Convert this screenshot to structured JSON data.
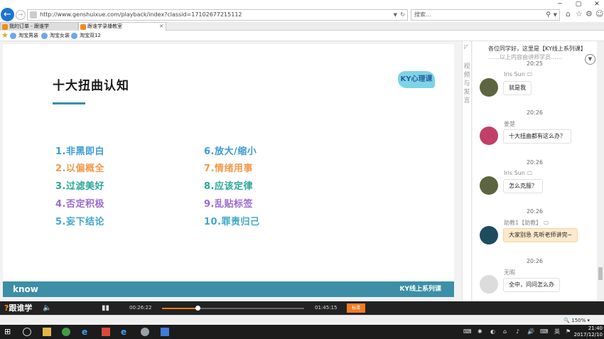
{
  "browser": {
    "url": "http://www.genshuixue.com/playback/index?classid=17102677215112",
    "search_placeholder": "搜索...",
    "tabs": [
      {
        "label": "我的订单 - 跟谁学"
      },
      {
        "label": "跟谁学录播教室"
      }
    ],
    "favorites": [
      {
        "label": "淘宝男装"
      },
      {
        "label": "淘宝女装"
      },
      {
        "label": "淘宝双12"
      }
    ],
    "zoom": "150%"
  },
  "slide": {
    "title": "十大扭曲认知",
    "logo_text": "KY心理课",
    "items_left": [
      "1.非黑即白",
      "2.以偏概全",
      "3.过滤美好",
      "4.否定积极",
      "5.妄下结论"
    ],
    "items_right": [
      "6.放大/缩小",
      "7.情绪用事",
      "8.应该定律",
      "9.乱贴标签",
      "10.罪责归己"
    ],
    "footer_left": "know",
    "footer_right": "KY线上系列课"
  },
  "side_tab": {
    "chars": [
      "视",
      "频",
      "与",
      "发",
      "言"
    ]
  },
  "chat": {
    "notice": "各位同学好，这里是【KY线上系列课】",
    "notice_line2": "……以上内容由讲师学员……",
    "messages": [
      {
        "time": "20:25",
        "name": "Iris Sun",
        "mark": "🖵",
        "text": "就是我",
        "assistant": false,
        "avatar_color": "#5b6640"
      },
      {
        "time": "20:26",
        "name": "姜楚",
        "mark": "",
        "text": "十大扭曲都有这么办？",
        "assistant": false,
        "avatar_color": "#c0406a"
      },
      {
        "time": "20:26",
        "name": "Iris Sun",
        "mark": "🖵",
        "text": "怎么克服？",
        "assistant": false,
        "avatar_color": "#5b6640"
      },
      {
        "time": "20:26",
        "name": "助教1【助教】",
        "mark": "🖵",
        "text": "大家别急 先听老师讲完~",
        "assistant": true,
        "avatar_color": "#1e4c5e"
      },
      {
        "time": "20:26",
        "name": "无暇",
        "mark": "",
        "text": "全中，问问怎么办",
        "assistant": false,
        "avatar_color": "#dcdcdc"
      }
    ]
  },
  "player": {
    "brand": "跟谁学",
    "current_time": "00:26:22",
    "duration": "01:45:15",
    "progress": 0.25,
    "rate_label": "标清"
  },
  "taskbar": {
    "tray_text": "英",
    "time": "21:40",
    "date": "2017/12/10"
  }
}
